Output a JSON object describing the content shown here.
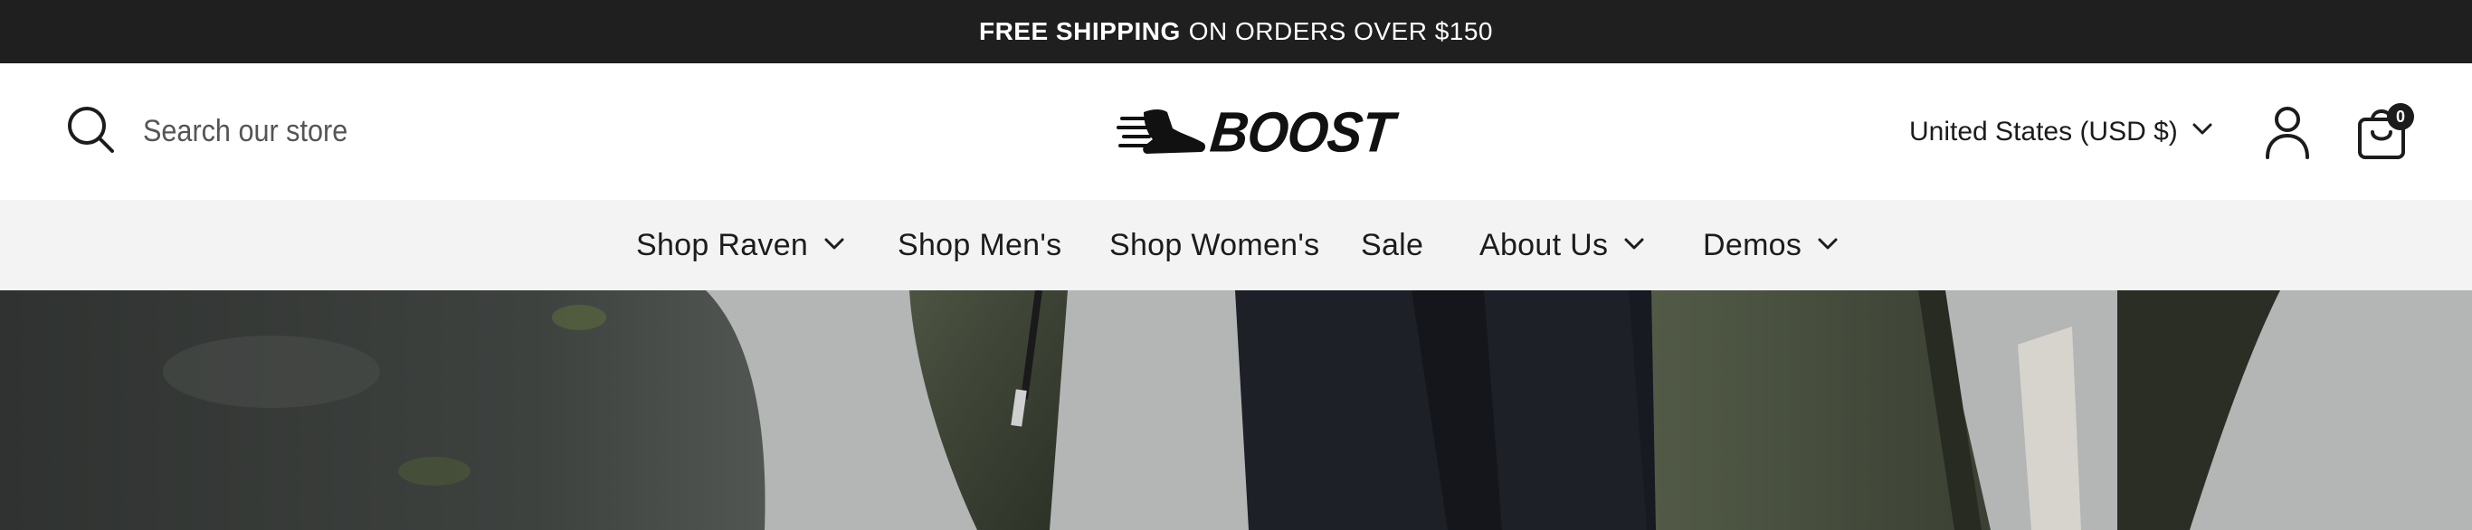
{
  "announcement": {
    "bold": "FREE SHIPPING",
    "rest": "ON ORDERS OVER $150"
  },
  "header": {
    "search_placeholder": "Search our store",
    "logo_text": "BOOST",
    "currency": "United States (USD $)",
    "cart_count": "0"
  },
  "nav": {
    "items": [
      {
        "label": "Shop Raven",
        "has_dropdown": true
      },
      {
        "label": "Shop Men's",
        "has_dropdown": false
      },
      {
        "label": "Shop Women's",
        "has_dropdown": false
      },
      {
        "label": "Sale",
        "has_dropdown": false
      },
      {
        "label": "About Us",
        "has_dropdown": true
      },
      {
        "label": "Demos",
        "has_dropdown": true
      }
    ]
  },
  "icons": {
    "search": "search-icon",
    "chevron": "chevron-down-icon",
    "account": "account-icon",
    "cart": "shopping-bag-icon",
    "logo": "running-shoe-logo"
  },
  "colors": {
    "announcement_bg": "#1f1f1f",
    "nav_bg": "#f3f3f3",
    "text": "#1c1c1c"
  }
}
